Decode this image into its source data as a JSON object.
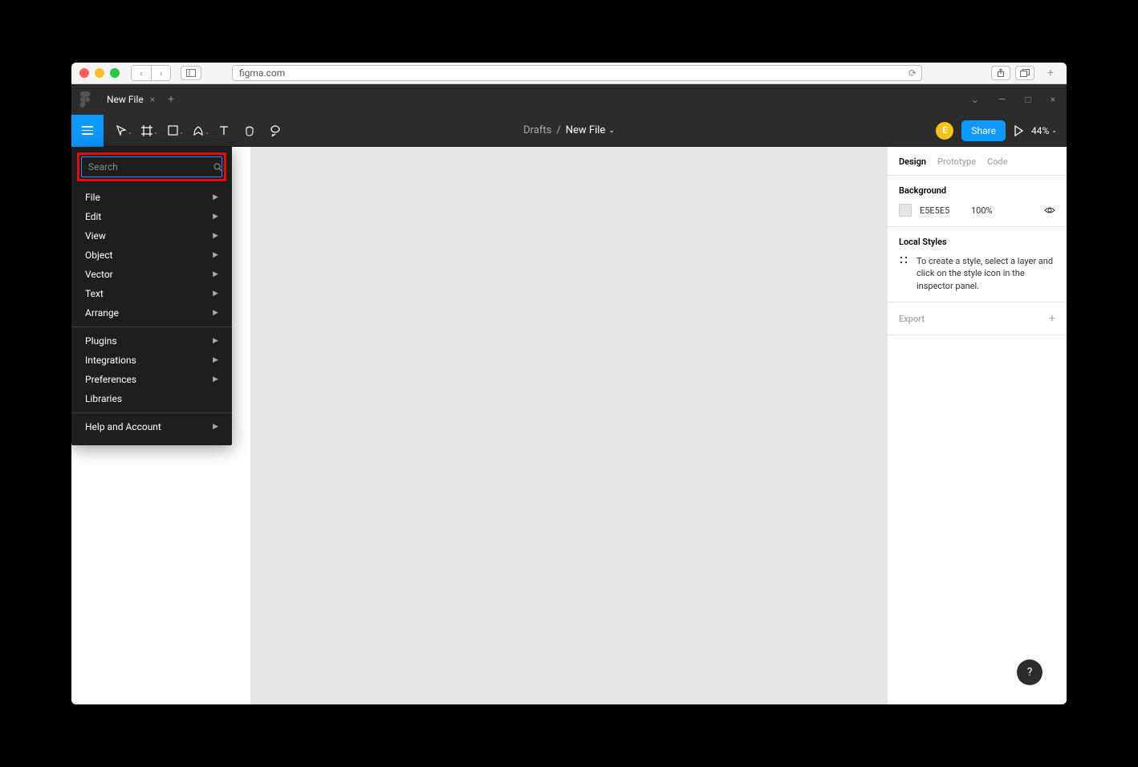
{
  "browser": {
    "url": "figma.com"
  },
  "titlebar": {
    "tab_name": "New File"
  },
  "toolbar": {
    "location_drafts": "Drafts",
    "location_file": "New File",
    "share_label": "Share",
    "avatar_initial": "E",
    "zoom": "44%"
  },
  "menu": {
    "search_placeholder": "Search",
    "groups": [
      [
        "File",
        "Edit",
        "View",
        "Object",
        "Vector",
        "Text",
        "Arrange"
      ],
      [
        "Plugins",
        "Integrations",
        "Preferences",
        "Libraries"
      ],
      [
        "Help and Account"
      ]
    ],
    "no_arrow": [
      "Libraries"
    ]
  },
  "right_panel": {
    "tabs": {
      "design": "Design",
      "prototype": "Prototype",
      "code": "Code"
    },
    "background": {
      "title": "Background",
      "hex": "E5E5E5",
      "opacity": "100%"
    },
    "local_styles": {
      "title": "Local Styles",
      "hint": "To create a style, select a layer and click on the style icon in the inspector panel."
    },
    "export": "Export"
  },
  "help": "?"
}
